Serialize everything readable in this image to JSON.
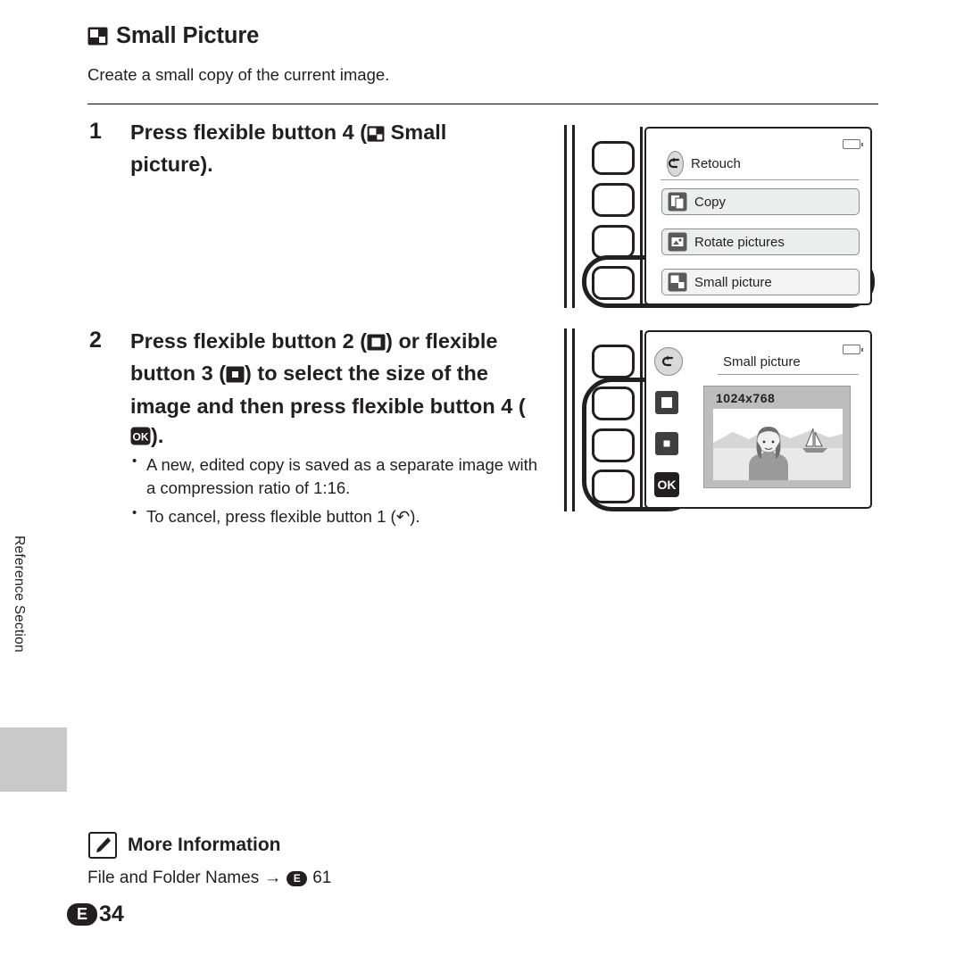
{
  "header": {
    "icon": "small-picture-icon",
    "title": "Small Picture",
    "subtitle": "Create a small copy of the current image."
  },
  "steps": [
    {
      "number": "1",
      "text_before": "Press flexible button 4 (",
      "icon": "small-picture-icon",
      "text_after": "Small picture).",
      "bullets": []
    },
    {
      "number": "2",
      "text_line1": "Press flexible button 2 (",
      "icon1": "large-square-icon",
      "text_line2": ") or flexible button 3 (",
      "icon2": "small-square-icon",
      "text_line3": ") to select the size of the image and then press flexible button 4 (",
      "icon3": "ok-icon",
      "text_line4": ").",
      "bullets": [
        "A new, edited copy is saved as a separate image with a compression ratio of 1:16.",
        "To cancel, press flexible button 1 (↶)."
      ]
    }
  ],
  "screen1": {
    "rows": [
      {
        "label": "Retouch",
        "icon": "back-arrow-icon",
        "style": "header"
      },
      {
        "label": "Copy",
        "icon": "copy-icon",
        "style": "normal"
      },
      {
        "label": "Rotate pictures",
        "icon": "rotate-pictures-icon",
        "style": "normal"
      },
      {
        "label": "Small picture",
        "icon": "small-picture-icon",
        "style": "selected"
      }
    ],
    "battery": "battery-icon"
  },
  "screen2": {
    "title": "Small picture",
    "resolution": "1024x768",
    "battery": "battery-icon",
    "buttons": [
      {
        "icon": "back-arrow-icon",
        "name": "back"
      },
      {
        "icon": "large-square-icon",
        "name": "size-large"
      },
      {
        "icon": "small-square-icon",
        "name": "size-small"
      },
      {
        "icon": "ok-icon",
        "label": "OK",
        "name": "ok"
      }
    ]
  },
  "more_information": {
    "icon": "pencil-icon",
    "title": "More Information",
    "link_text": "File and Folder Names",
    "arrow": "→",
    "badge": "E",
    "page_ref": "61"
  },
  "footer": {
    "badge": "E",
    "page": "34"
  },
  "side_tab": {
    "label": "Reference Section"
  }
}
